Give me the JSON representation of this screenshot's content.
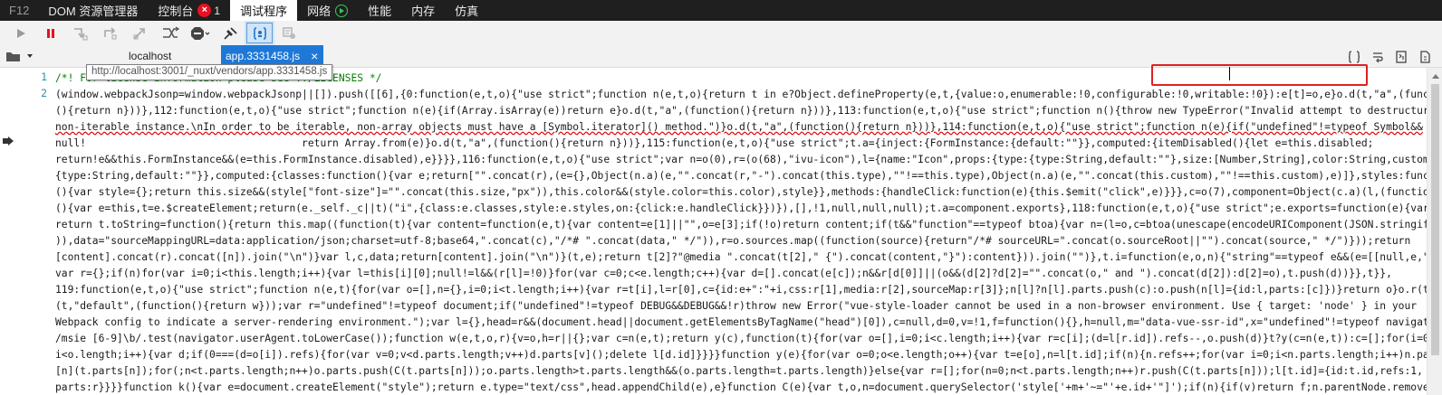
{
  "topbar": {
    "tabs": [
      {
        "label": "F12"
      },
      {
        "label": "DOM 资源管理器"
      },
      {
        "label": "控制台",
        "error_count": "1"
      },
      {
        "label": "调试程序"
      },
      {
        "label": "网络"
      },
      {
        "label": "性能"
      },
      {
        "label": "内存"
      },
      {
        "label": "仿真"
      }
    ],
    "error_icon": "×"
  },
  "toolbar": {
    "icons": [
      "continue-icon",
      "break-icon",
      "step-into-icon",
      "step-over-icon",
      "step-out-icon",
      "break-on-new-worker-icon",
      "exception-behavior-icon",
      "disable-breakpoints-icon",
      "pretty-print-icon",
      "just-my-code-icon"
    ]
  },
  "sources": {
    "folder_icon": "folder-icon",
    "host": "localhost",
    "active_file": "app.3331458.js",
    "close": "×"
  },
  "tooltip": "http://localhost:3001/_nuxt/vendors/app.3331458.js",
  "code": {
    "line_numbers": [
      "1",
      "2"
    ],
    "lines": [
      "/*! For license information please see ../LICENSES */",
      "(window.webpackJsonp=window.webpackJsonp||[]).push([[6],{0:function(e,t,o){\"use strict\";function n(e,t,o){return t in e?Object.defineProperty(e,t,{value:o,enumerable:!0,configurable:!0,writable:!0}):e[t]=o,e}o.d(t,\"a\",(function",
      "(){return n}))},112:function(e,t,o){\"use strict\";function n(e){if(Array.isArray(e))return e}o.d(t,\"a\",(function(){return n}))},113:function(e,t,o){\"use strict\";function n(){throw new TypeError(\"Invalid attempt to destructure",
      "non-iterable instance.\\nIn order to be iterable, non-array objects must have a [Symbol.iterator]() method.\")}o.d(t,\"a\",(function(){return n}))},114:function(e,t,o){\"use strict\";function n(e){if(\"undefined\"!=typeof Symbol&&",
      "null!                                   return Array.from(e)}o.d(t,\"a\",(function(){return n}))},115:function(e,t,o){\"use strict\";t.a={inject:{FormInstance:{default:\"\"}},computed:{itemDisabled(){let e=this.disabled;",
      "return!e&&this.FormInstance&&(e=this.FormInstance.disabled),e}}}},116:function(e,t,o){\"use strict\";var n=o(0),r=(o(68),\"ivu-icon\"),l={name:\"Icon\",props:{type:{type:String,default:\"\"},size:[Number,String],color:String,custom:",
      "{type:String,default:\"\"}},computed:{classes:function(){var e;return[\"\".concat(r),(e={},Object(n.a)(e,\"\".concat(r,\"-\").concat(this.type),\"\"!==this.type),Object(n.a)(e,\"\".concat(this.custom),\"\"!==this.custom),e)]},styles:function",
      "(){var style={};return this.size&&(style[\"font-size\"]=\"\".concat(this.size,\"px\")),this.color&&(style.color=this.color),style}},methods:{handleClick:function(e){this.$emit(\"click\",e)}}},c=o(7),component=Object(c.a)(l,(function",
      "(){var e=this,t=e.$createElement;return(e._self._c||t)(\"i\",{class:e.classes,style:e.styles,on:{click:e.handleClick}})}),[],!1,null,null,null);t.a=component.exports},118:function(e,t,o){\"use strict\";e.exports=function(e){var t=[];",
      "return t.toString=function(){return this.map((function(t){var content=function(e,t){var content=e[1]||\"\",o=e[3];if(!o)return content;if(t&&\"function\"==typeof btoa){var n=(l=o,c=btoa(unescape(encodeURIComponent(JSON.stringify(l)))",
      ")),data=\"sourceMappingURL=data:application/json;charset=utf-8;base64,\".concat(c),\"/*# \".concat(data,\" */\")),r=o.sources.map((function(source){return\"/*# sourceURL=\".concat(o.sourceRoot||\"\").concat(source,\" */\")}));return",
      "[content].concat(r).concat([n]).join(\"\\n\")}var l,c,data;return[content].join(\"\\n\")}(t,e);return t[2]?\"@media \".concat(t[2],\" {\").concat(content,\"}\"):content})).join(\"\")},t.i=function(e,o,n){\"string\"==typeof e&&(e=[[null,e,\"\"]]);",
      "var r={};if(n)for(var i=0;i<this.length;i++){var l=this[i][0];null!=l&&(r[l]=!0)}for(var c=0;c<e.length;c++){var d=[].concat(e[c]);n&&r[d[0]]||(o&&(d[2]?d[2]=\"\".concat(o,\" and \").concat(d[2]):d[2]=o),t.push(d))}},t}},",
      "119:function(e,t,o){\"use strict\";function n(e,t){for(var o=[],n={},i=0;i<t.length;i++){var r=t[i],l=r[0],c={id:e+\":\"+i,css:r[1],media:r[2],sourceMap:r[3]};n[l]?n[l].parts.push(c):o.push(n[l]={id:l,parts:[c]})}return o}o.r(t),o.d",
      "(t,\"default\",(function(){return w}));var r=\"undefined\"!=typeof document;if(\"undefined\"!=typeof DEBUG&&DEBUG&&!r)throw new Error(\"vue-style-loader cannot be used in a non-browser environment. Use { target: 'node' } in your",
      "Webpack config to indicate a server-rendering environment.\");var l={},head=r&&(document.head||document.getElementsByTagName(\"head\")[0]),c=null,d=0,v=!1,f=function(){},h=null,m=\"data-vue-ssr-id\",x=\"undefined\"!=typeof navigator&&",
      "/msie [6-9]\\b/.test(navigator.userAgent.toLowerCase());function w(e,t,o,r){v=o,h=r||{};var c=n(e,t);return y(c),function(t){for(var o=[],i=0;i<c.length;i++){var r=c[i];(d=l[r.id]).refs--,o.push(d)}t?y(c=n(e,t)):c=[];for(i=0;",
      "i<o.length;i++){var d;if(0===(d=o[i]).refs){for(var v=0;v<d.parts.length;v++)d.parts[v]();delete l[d.id]}}}}function y(e){for(var o=0;o<e.length;o++){var t=e[o],n=l[t.id];if(n){n.refs++;for(var i=0;i<n.parts.length;i++)n.parts[i](t.parts[i]);",
      "[n](t.parts[n]);for(;n<t.parts.length;n++)o.parts.push(C(t.parts[n]));o.parts.length>t.parts.length&&(o.parts.length=t.parts.length)}else{var r=[];for(n=0;n<t.parts.length;n++)r.push(C(t.parts[n]));l[t.id]={id:t.id,refs:1,",
      "parts:r}}}}function k(){var e=document.createElement(\"style\");return e.type=\"text/css\",head.appendChild(e),e}function C(e){var t,o,n=document.querySelector('style['+m+'~=\"'+e.id+'\"]');if(n){if(v)return f;n.parentNode.removeChild"
    ]
  }
}
